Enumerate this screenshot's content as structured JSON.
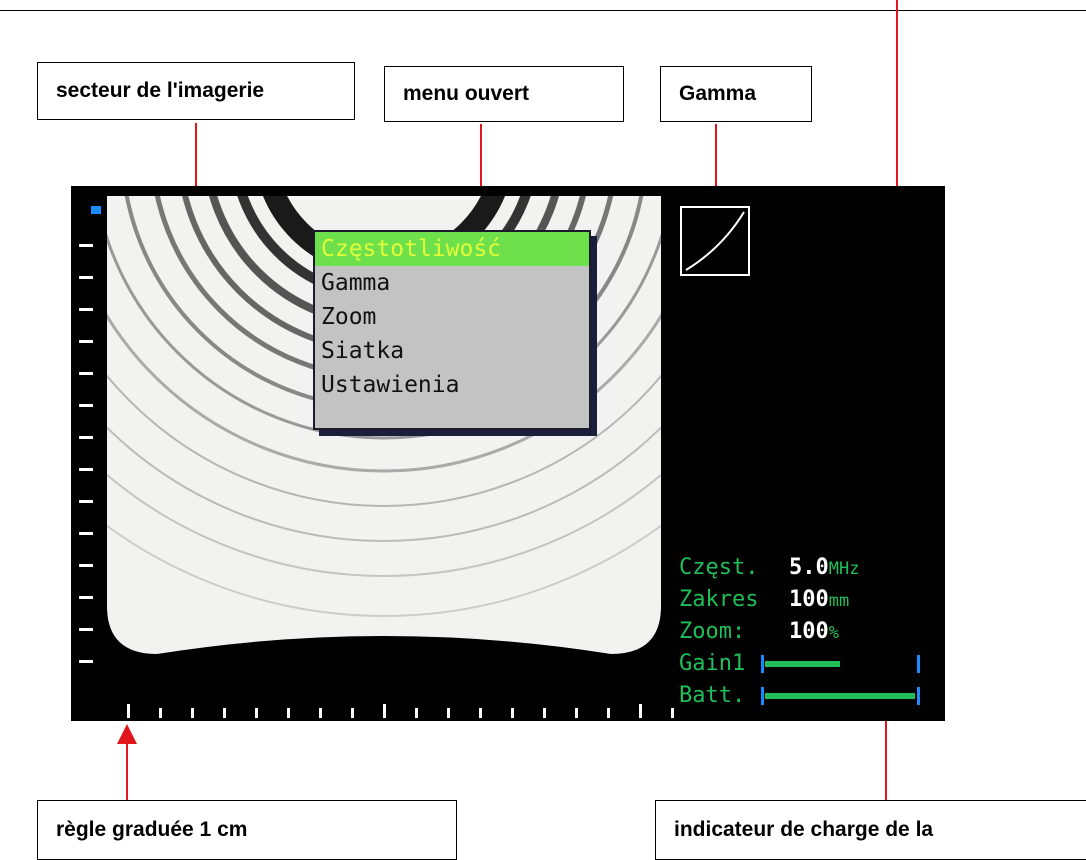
{
  "callouts": {
    "sector": "secteur de l'imagerie",
    "menu": "menu ouvert",
    "gamma": "Gamma",
    "ruler": "règle graduée 1 cm",
    "battery": "indicateur de charge de la"
  },
  "menu": {
    "items": [
      "Częstotliwość",
      "Gamma",
      "Zoom",
      "Siatka",
      "Ustawienia"
    ],
    "selected_index": 0
  },
  "status": {
    "freq_label": "Częst.",
    "freq_value": "5.0",
    "freq_unit": "MHz",
    "range_label": "Zakres",
    "range_value": "100",
    "range_unit": "mm",
    "zoom_label": "Zoom:",
    "zoom_value": "100",
    "zoom_unit": "%",
    "gain_label": "Gain1",
    "gain_level": 0.5,
    "battery_label": "Batt.",
    "battery_level": 1.0
  },
  "colors": {
    "arrow": "#e0161b",
    "status_green": "#1fbf5a",
    "menu_highlight": "#6ee04c",
    "scale_blue": "#1a8cff"
  }
}
